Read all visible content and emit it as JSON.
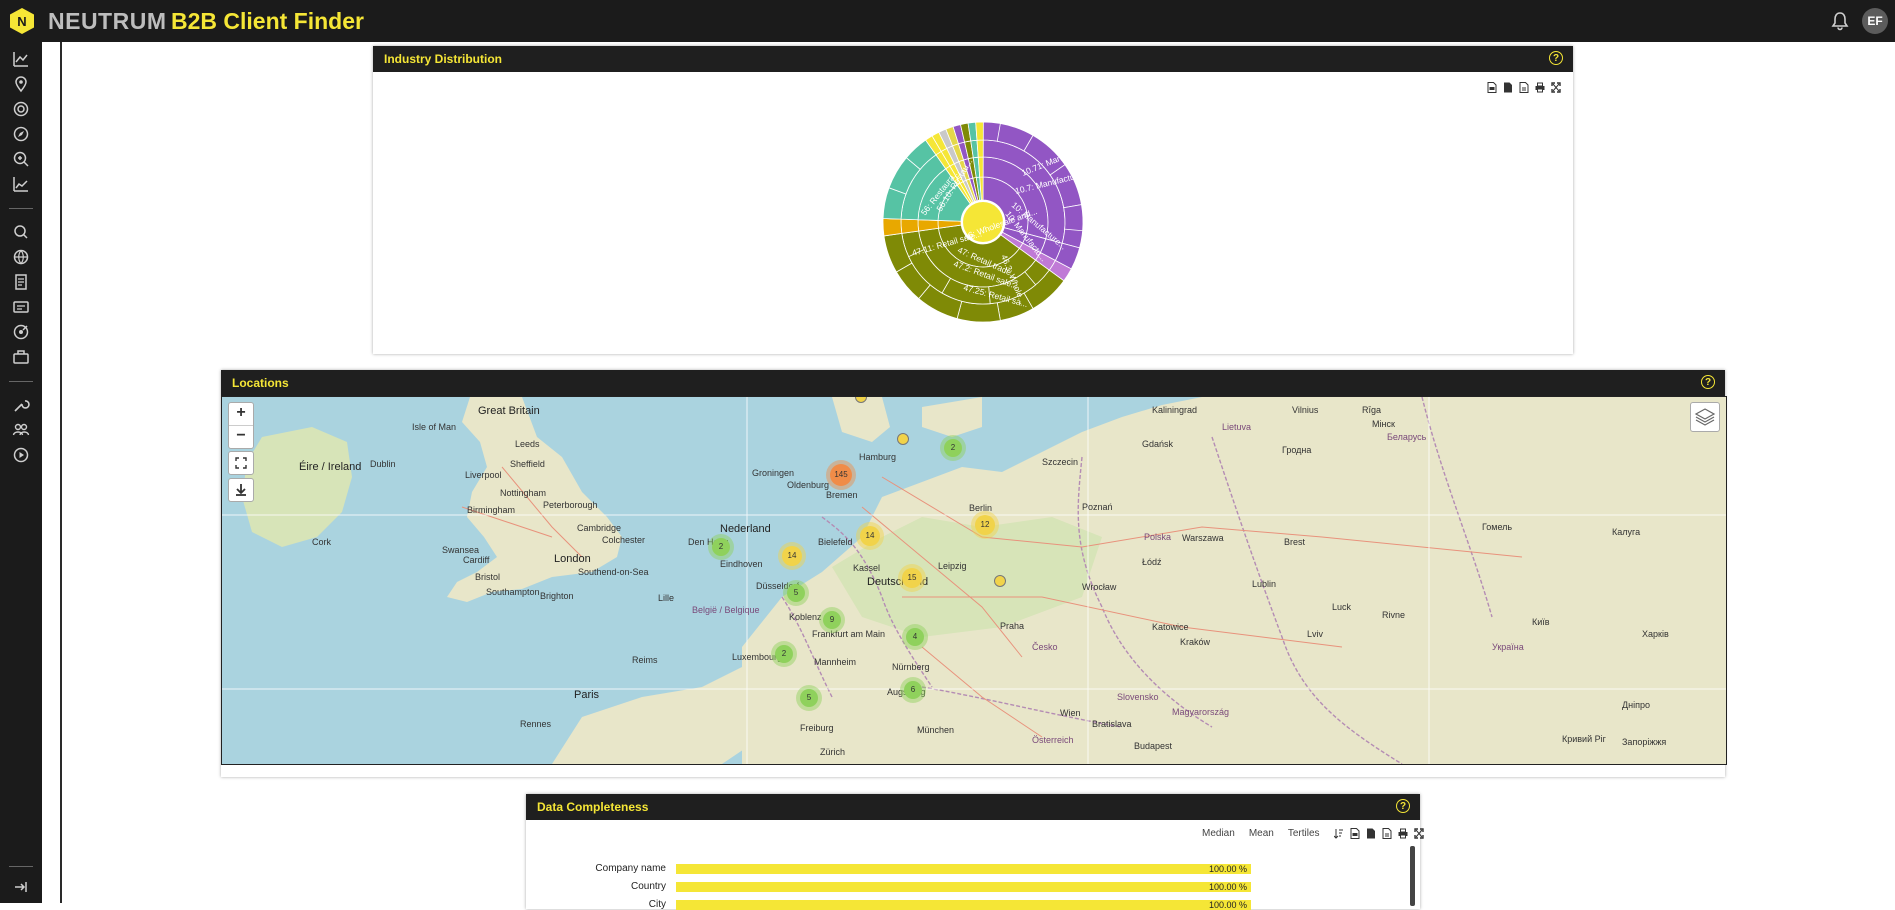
{
  "header": {
    "brand": "NEUTRUM",
    "logo_letter": "N",
    "app_title": "B2B Client Finder",
    "user_initials": "EF",
    "brand_color": "#f5e636"
  },
  "sidebar": {
    "top_icons": [
      "chart-line-icon",
      "map-pin-icon",
      "target-icon",
      "compass-icon",
      "search-zoom-icon",
      "trend-icon"
    ],
    "middle_icons": [
      "search-icon",
      "globe-icon",
      "document-icon",
      "id-card-icon",
      "target-alt-icon",
      "briefcase-icon"
    ],
    "bottom_icons": [
      "wrench-icon",
      "users-icon",
      "play-icon"
    ],
    "logout_icon": "logout-icon"
  },
  "industry_panel": {
    "title": "Industry Distribution",
    "help": "?",
    "sunburst_labels": [
      "10.71: Manufactur...",
      "10.7: Manufacture...",
      "10: Manufacture...",
      "10: Manufactu...",
      "56: Restaura...",
      "56.10: Restau...",
      "46: Wholesale and...",
      "47: Retail trade...",
      "47.2: Retail sale...",
      "47.25: Retail sa...",
      "47.11: Retail sale...",
      "46.3: Whole..."
    ],
    "colors": {
      "manufacturing": "#9256c4",
      "restaurants": "#56c3a4",
      "trade": "#7f8a06",
      "center": "#f5e636",
      "other": "#e8a800"
    }
  },
  "locations_panel": {
    "title": "Locations",
    "help": "?",
    "zoom_in": "+",
    "zoom_out": "−",
    "clusters": [
      {
        "label": "145",
        "color": "orange"
      },
      {
        "label": "14",
        "color": "yellow"
      },
      {
        "label": "14",
        "color": "yellow"
      },
      {
        "label": "12",
        "color": "yellow"
      },
      {
        "label": "15",
        "color": "yellow"
      },
      {
        "label": "2",
        "color": "green"
      },
      {
        "label": "2",
        "color": "green"
      },
      {
        "label": "5",
        "color": "green"
      },
      {
        "label": "9",
        "color": "green"
      },
      {
        "label": "4",
        "color": "green"
      },
      {
        "label": "2",
        "color": "green"
      },
      {
        "label": "5",
        "color": "green"
      },
      {
        "label": "6",
        "color": "green"
      }
    ],
    "places": [
      {
        "name": "Great Britain",
        "big": true
      },
      {
        "name": "Isle of Man"
      },
      {
        "name": "Leeds"
      },
      {
        "name": "Sheffield"
      },
      {
        "name": "Liverpool"
      },
      {
        "name": "Nottingham"
      },
      {
        "name": "Birmingham"
      },
      {
        "name": "Peterborough"
      },
      {
        "name": "Cambridge"
      },
      {
        "name": "Colchester"
      },
      {
        "name": "London"
      },
      {
        "name": "Southend-on-Sea"
      },
      {
        "name": "Bristol"
      },
      {
        "name": "Cardiff"
      },
      {
        "name": "Southampton"
      },
      {
        "name": "Brighton"
      },
      {
        "name": "Swansea"
      },
      {
        "name": "Cork"
      },
      {
        "name": "Dublin"
      },
      {
        "name": "Éire / Ireland"
      },
      {
        "name": "Groningen"
      },
      {
        "name": "Oldenburg"
      },
      {
        "name": "Bremen"
      },
      {
        "name": "Hamburg"
      },
      {
        "name": "Nederland"
      },
      {
        "name": "Den Haag"
      },
      {
        "name": "Eindhoven"
      },
      {
        "name": "Düsseldorf"
      },
      {
        "name": "Bielefeld"
      },
      {
        "name": "Kassel"
      },
      {
        "name": "Deutschland"
      },
      {
        "name": "Leipzig"
      },
      {
        "name": "Berlin"
      },
      {
        "name": "Koblenz"
      },
      {
        "name": "Frankfurt am Main"
      },
      {
        "name": "Mannheim"
      },
      {
        "name": "Nürnberg"
      },
      {
        "name": "Augsburg"
      },
      {
        "name": "München"
      },
      {
        "name": "Freiburg"
      },
      {
        "name": "Zürich"
      },
      {
        "name": "Lille"
      },
      {
        "name": "België / Belgique"
      },
      {
        "name": "Luxembourg"
      },
      {
        "name": "Reims"
      },
      {
        "name": "Rennes"
      },
      {
        "name": "Paris"
      },
      {
        "name": "Praha"
      },
      {
        "name": "Česko"
      },
      {
        "name": "Wien"
      },
      {
        "name": "Österreich"
      },
      {
        "name": "Bratislava"
      },
      {
        "name": "Budapest"
      },
      {
        "name": "Polska"
      },
      {
        "name": "Warszawa"
      },
      {
        "name": "Łódź"
      },
      {
        "name": "Kraków"
      },
      {
        "name": "Katowice"
      },
      {
        "name": "Wrocław"
      },
      {
        "name": "Poznań"
      },
      {
        "name": "Gdańsk"
      },
      {
        "name": "Szczecin"
      },
      {
        "name": "Lublin"
      },
      {
        "name": "Brest"
      },
      {
        "name": "Гомель"
      },
      {
        "name": "Беларусь"
      },
      {
        "name": "Мінск"
      },
      {
        "name": "Гродна"
      },
      {
        "name": "Калуга"
      },
      {
        "name": "Київ"
      },
      {
        "name": "Україна"
      },
      {
        "name": "Харків"
      },
      {
        "name": "Дніпро"
      },
      {
        "name": "Кривий Ріг"
      },
      {
        "name": "Запоріжжя"
      },
      {
        "name": "Kaliningrad"
      },
      {
        "name": "Vilnius"
      },
      {
        "name": "Rīga"
      },
      {
        "name": "Lietuva"
      },
      {
        "name": "Slovensko"
      },
      {
        "name": "Magyarország"
      },
      {
        "name": "Luck"
      },
      {
        "name": "Rivne"
      },
      {
        "name": "Lviv"
      }
    ]
  },
  "completeness_panel": {
    "title": "Data Completeness",
    "help": "?",
    "toolbar": [
      "Median",
      "Mean",
      "Tertiles"
    ],
    "rows": [
      {
        "label": "Company name",
        "value": "100.00 %",
        "fraction": 1.0
      },
      {
        "label": "Country",
        "value": "100.00 %",
        "fraction": 1.0
      },
      {
        "label": "City",
        "value": "100.00 %",
        "fraction": 1.0
      }
    ]
  }
}
